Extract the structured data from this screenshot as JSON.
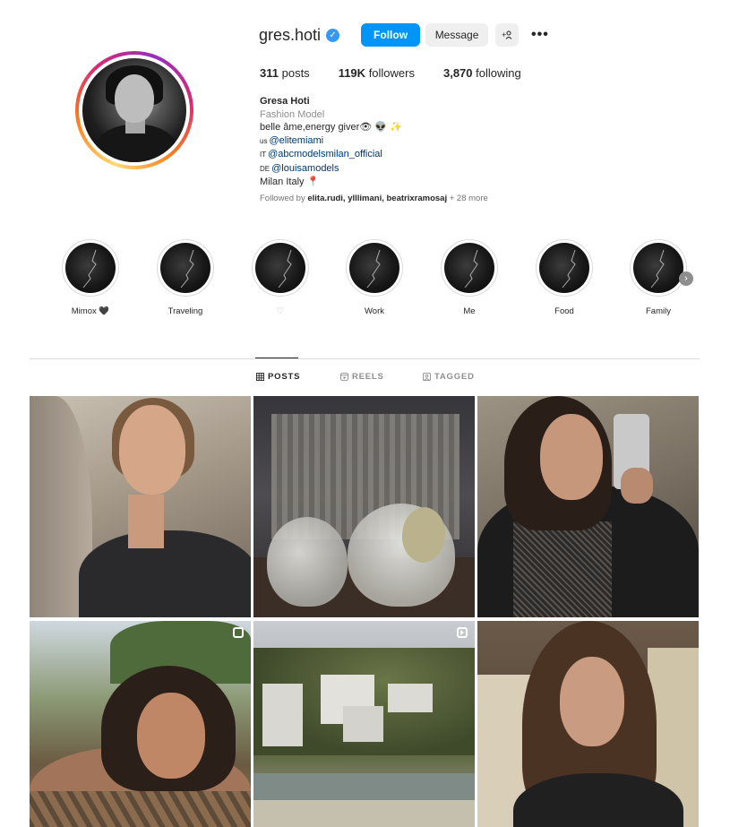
{
  "profile": {
    "username": "gres.hoti",
    "verified": true,
    "buttons": {
      "follow": "Follow",
      "message": "Message",
      "suggest": "+1"
    },
    "more_icon": "more-horizontal-icon"
  },
  "stats": [
    {
      "count": "311",
      "label": "posts"
    },
    {
      "count": "119K",
      "label": "followers"
    },
    {
      "count": "3,870",
      "label": "following"
    }
  ],
  "bio": {
    "name": "Gresa Hoti",
    "category": "Fashion Model",
    "line1": "belle âme,energy giver👁 👽 ✨",
    "agency_us_flag": "us",
    "agency_us": "@elitemiami",
    "agency_it_flag": "IT",
    "agency_it": "@abcmodelsmilan_official",
    "agency_de_flag": "DE",
    "agency_de": "@louisamodels",
    "location": "Milan Italy 📍",
    "followed_prefix": "Followed by ",
    "followed_names": "elita.rudi, ylllimani, beatrixramosaj",
    "followed_more": " + 28 more"
  },
  "highlights": [
    {
      "label": "Mimox 🖤"
    },
    {
      "label": "Traveling"
    },
    {
      "label": "♡"
    },
    {
      "label": "Work"
    },
    {
      "label": "Me"
    },
    {
      "label": "Food"
    },
    {
      "label": "Family"
    }
  ],
  "tabs": [
    {
      "label": "POSTS",
      "icon": "grid-icon",
      "active": true
    },
    {
      "label": "REELS",
      "icon": "reels-icon",
      "active": false
    },
    {
      "label": "TAGGED",
      "icon": "tagged-icon",
      "active": false
    }
  ],
  "posts": [
    {
      "kind": "photo",
      "badge": "none"
    },
    {
      "kind": "photo",
      "badge": "none"
    },
    {
      "kind": "photo",
      "badge": "none"
    },
    {
      "kind": "photo",
      "badge": "carousel"
    },
    {
      "kind": "photo",
      "badge": "reel"
    },
    {
      "kind": "photo",
      "badge": "none"
    }
  ],
  "colors": {
    "follow_button": "#0095f6",
    "verified": "#3897f0",
    "link": "#00376b",
    "muted": "#8e8e8e"
  }
}
